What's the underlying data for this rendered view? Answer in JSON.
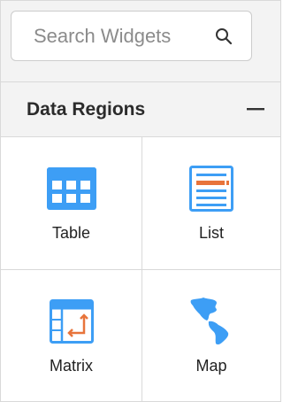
{
  "search": {
    "placeholder": "Search Widgets",
    "value": ""
  },
  "section": {
    "title": "Data Regions",
    "collapse_symbol": "—"
  },
  "widgets": [
    {
      "label": "Table",
      "icon": "table-icon"
    },
    {
      "label": "List",
      "icon": "list-icon"
    },
    {
      "label": "Matrix",
      "icon": "matrix-icon"
    },
    {
      "label": "Map",
      "icon": "map-icon"
    }
  ],
  "colors": {
    "accent_blue": "#3d9ef5",
    "accent_orange": "#e8743b",
    "panel_bg": "#f3f3f3",
    "border": "#d9d9d9"
  }
}
